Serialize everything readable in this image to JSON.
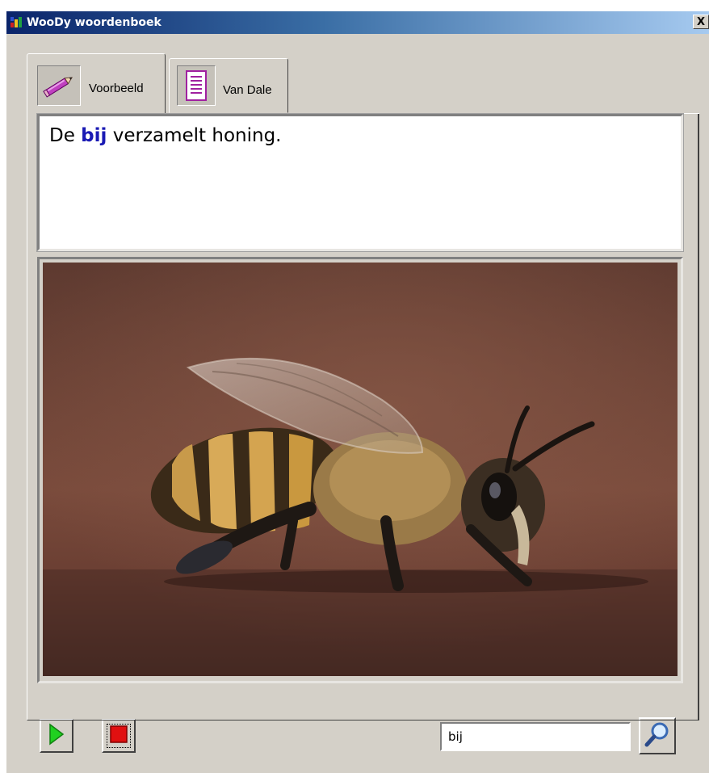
{
  "window": {
    "title": "WooDy woordenboek",
    "close_label": "X"
  },
  "tabs": [
    {
      "label": "Voorbeeld",
      "icon": "pencil-icon",
      "active": true
    },
    {
      "label": "Van Dale",
      "icon": "document-icon",
      "active": false
    }
  ],
  "example": {
    "prefix": "De ",
    "keyword": "bij",
    "suffix": " verzamelt honing.",
    "keyword_color": "#1a1ab4"
  },
  "image": {
    "subject": "honeybee-photo"
  },
  "controls": {
    "play_icon": "play-icon",
    "stop_icon": "stop-icon",
    "search_value": "bij",
    "search_icon": "magnifier-icon"
  }
}
